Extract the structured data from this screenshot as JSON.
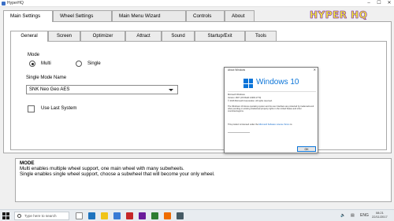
{
  "window": {
    "title": "HyperHQ",
    "logo_text": "HYPER HQ"
  },
  "main_tabs": [
    "Main Settings",
    "Wheel Settings",
    "Main Menu Wizard",
    "Controls",
    "About"
  ],
  "sub_tabs": [
    "General",
    "Screen",
    "Optimizer",
    "Attract",
    "Sound",
    "Startup/Exit",
    "Tools"
  ],
  "general": {
    "mode_label": "Mode",
    "mode_options": [
      "Multi",
      "Single"
    ],
    "mode_selected": "Multi",
    "single_mode_name_label": "Single Mode Name",
    "single_mode_name_value": "SNK Neo Geo AES",
    "use_last_system_label": "Use Last System",
    "use_last_system_checked": false
  },
  "about_dialog": {
    "title": "About Windows",
    "wordmark": "Windows 10",
    "lines": [
      "Microsoft Windows",
      "Version 1607 (OS Build 14393.1770)",
      "© 2016 Microsoft Corporation. All rights reserved."
    ],
    "body": "The Windows 10 Home operating system and its user interface are protected by trademark and other pending or existing intellectual property rights in the United States and other countries/regions.",
    "licensed_prefix": "This product is licensed under the ",
    "licensed_link": "Microsoft Software License Terms",
    "licensed_suffix": " to:",
    "ok_label": "OK"
  },
  "description": {
    "title": "MODE",
    "lines": [
      "Multi enables multiple wheel support, one main wheel with many subwheels.",
      "Single enables single wheel support, choose a subwheel that will become your only wheel."
    ]
  },
  "taskbar": {
    "search_placeholder": "Type here to search",
    "tray_lang": "ENG",
    "time": "08:21",
    "date": "22/11/2017"
  },
  "colors": {
    "accent": "#0a74d8",
    "logo_fill": "#f6f23a",
    "logo_outline": "#7b1fa2"
  }
}
